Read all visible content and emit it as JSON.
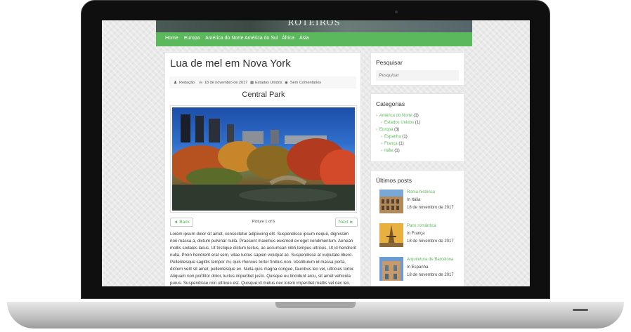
{
  "site": {
    "title": "ROTEIROS"
  },
  "nav": {
    "items": [
      "Home",
      "Europa",
      "América do Norte",
      "América do Sul",
      "África",
      "Ásia"
    ]
  },
  "post": {
    "title": "Lua de mel em Nova York",
    "meta": {
      "author": "Redação",
      "date": "18 de novembro de 2017",
      "category": "Estados Unidos",
      "comments": "Sem Comentários"
    },
    "subtitle": "Central Park",
    "gallery": {
      "back_label": "◄ Back",
      "next_label": "Next ►",
      "caption": "Picture 1 of 6"
    },
    "body": "Lorem ipsum dolor sit amet, consectetur adipiscing elit. Suspendisse ipsum neque, dignissim non massa a, dictum pulvinar nulla. Praesent maximus euismod ex eget condimentum. Aenean mollis sodales lacus. Ut tristique dictum lectus, ac accumsan nibh tempus ultrices. Ut id hendrerit nulla. Proin hendrerit erat sem, vitae luctus sapien volutpat ac. Suspendisse at vulputate libero. Pellentesque sagittis tempor mi, quis rhoncus tortor finibus non. Vestibulum id massa porta, dictum velit sit amet, pellentesque ex. Nulla quis magna congue, faucibus leo vel, ultricies tortor. Aliquam non porttitor dolor, luctus imperdiet justo. Quisque eu tincidunt arcu, sit amet vehicula purus. Suspendisse non ultrices est. Quisque id metus nec lorem imperdiet mattis vel nec leo."
  },
  "sidebar": {
    "search": {
      "title": "Pesquisar",
      "placeholder": "Pesquisar"
    },
    "categories": {
      "title": "Categorias",
      "items": [
        {
          "name": "América do Norte",
          "count": "(1)"
        },
        {
          "name": "Estados Unidos",
          "count": "(1)"
        },
        {
          "name": "Europa",
          "count": "(3)"
        },
        {
          "name": "Espanha",
          "count": "(1)"
        },
        {
          "name": "França",
          "count": "(1)"
        },
        {
          "name": "Itália",
          "count": "(1)"
        }
      ]
    },
    "latest": {
      "title": "Últimos posts",
      "posts": [
        {
          "title": "Roma histórica",
          "category": "In Itália",
          "date": "18 de novembro de 2017"
        },
        {
          "title": "Paris romântica",
          "category": "In França",
          "date": "18 de novembro de 2017"
        },
        {
          "title": "Arquitetura de Barcelona",
          "category": "In Espanha",
          "date": "18 de novembro de 2017"
        }
      ]
    }
  },
  "colors": {
    "accent": "#5cb85c",
    "text": "#333333",
    "background": "#e9e9e9"
  }
}
